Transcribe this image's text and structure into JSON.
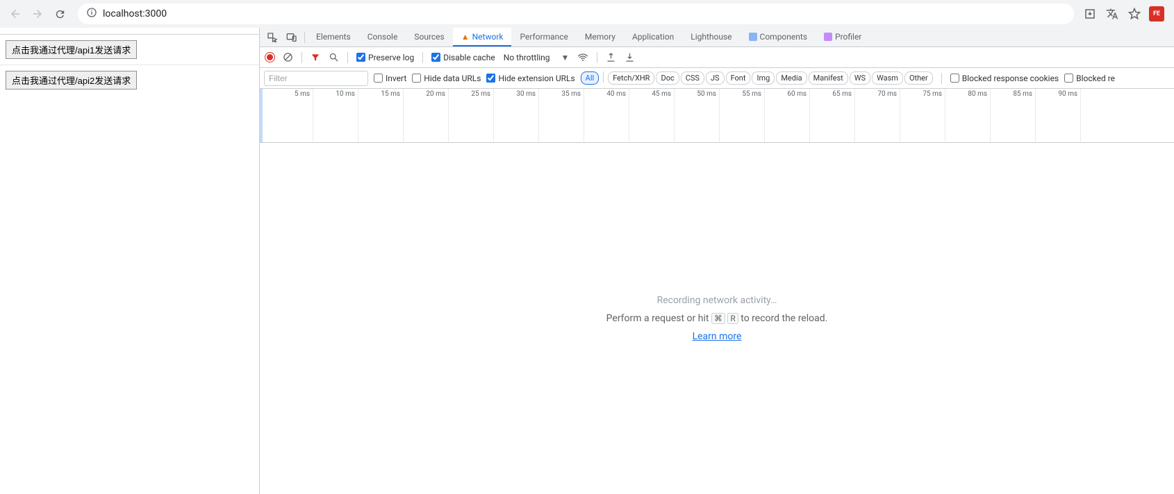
{
  "browser": {
    "url": "localhost:3000"
  },
  "page": {
    "button1_label": "点击我通过代理/api1发送请求",
    "button2_label": "点击我通过代理/api2发送请求"
  },
  "devtools": {
    "tabs": {
      "elements": "Elements",
      "console": "Console",
      "sources": "Sources",
      "network": "Network",
      "performance": "Performance",
      "memory": "Memory",
      "application": "Application",
      "lighthouse": "Lighthouse",
      "components": "Components",
      "profiler": "Profiler"
    },
    "toolbar": {
      "preserve_log": "Preserve log",
      "disable_cache": "Disable cache",
      "throttling": "No throttling"
    },
    "filterbar": {
      "filter_placeholder": "Filter",
      "invert": "Invert",
      "hide_data_urls": "Hide data URLs",
      "hide_ext_urls": "Hide extension URLs",
      "chips": {
        "all": "All",
        "fetch_xhr": "Fetch/XHR",
        "doc": "Doc",
        "css": "CSS",
        "js": "JS",
        "font": "Font",
        "img": "Img",
        "media": "Media",
        "manifest": "Manifest",
        "ws": "WS",
        "wasm": "Wasm",
        "other": "Other"
      },
      "blocked_cookies": "Blocked response cookies",
      "blocked_requests": "Blocked re"
    },
    "timeline_ticks": [
      "5 ms",
      "10 ms",
      "15 ms",
      "20 ms",
      "25 ms",
      "30 ms",
      "35 ms",
      "40 ms",
      "45 ms",
      "50 ms",
      "55 ms",
      "60 ms",
      "65 ms",
      "70 ms",
      "75 ms",
      "80 ms",
      "85 ms",
      "90 ms"
    ],
    "empty": {
      "line1": "Recording network activity…",
      "line2_a": "Perform a request or hit ",
      "line2_kbd1": "⌘",
      "line2_kbd2": "R",
      "line2_b": " to record the reload.",
      "learn_more": "Learn more"
    }
  }
}
